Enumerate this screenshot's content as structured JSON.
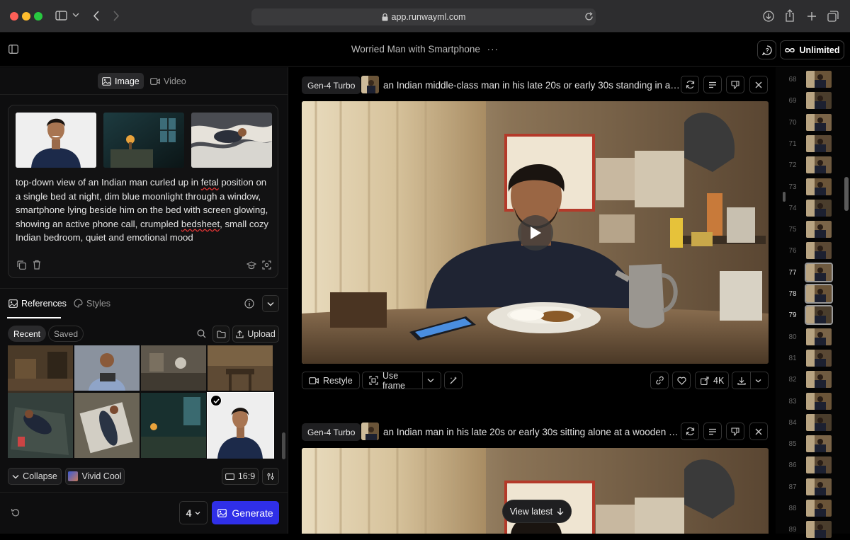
{
  "browser": {
    "url": "app.runwayml.com"
  },
  "header": {
    "title": "Worried Man with Smartphone",
    "more": "···",
    "plan": "Unlimited"
  },
  "left": {
    "mode_tabs": [
      "Image",
      "Video"
    ],
    "prompt": {
      "parts": [
        "top-down view of an Indian man curled up in ",
        "fetal",
        " position on a single bed at night, dim blue moonlight through a window, smartphone lying beside him on the bed with screen glowing, showing an active phone call, crumpled ",
        "bedsheet",
        ", small cozy Indian bedroom, quiet and emotional mood"
      ]
    },
    "panel_tabs": [
      "References",
      "Styles"
    ],
    "filter_tabs": [
      "Recent",
      "Saved"
    ],
    "upload": "Upload",
    "collapse": "Collapse",
    "style": "Vivid Cool",
    "ratio": "16:9",
    "count": "4",
    "generate": "Generate"
  },
  "generations": [
    {
      "model": "Gen-4 Turbo",
      "prompt": "an Indian middle-class man in his late 20s or early 30s standing in a m..."
    },
    {
      "model": "Gen-4 Turbo",
      "prompt": "an Indian man in his late 20s or early 30s sitting alone at a wooden di..."
    }
  ],
  "toolbar": {
    "restyle": "Restyle",
    "use_frame": "Use frame",
    "resolution": "4K"
  },
  "view_latest": "View latest",
  "strip": {
    "numbers": [
      "68",
      "69",
      "70",
      "71",
      "72",
      "73",
      "74",
      "75",
      "76",
      "77",
      "78",
      "79",
      "80",
      "81",
      "82",
      "83",
      "84",
      "85",
      "86",
      "87",
      "88",
      "89"
    ],
    "selected": [
      "77",
      "78",
      "79"
    ]
  },
  "colors": {
    "accent": "#2f2fe8",
    "bg": "#000000",
    "panel": "#0e0e0f"
  },
  "icons": [
    "sidebar-icon",
    "lock-icon",
    "reload-icon",
    "download-icon",
    "share-icon",
    "plus-icon",
    "tabs-icon",
    "chat-icon",
    "infinity-icon",
    "image-icon",
    "video-icon",
    "copy-icon",
    "trash-icon",
    "hat-icon",
    "scan-icon",
    "info-icon",
    "search-icon",
    "folder-icon",
    "upload-icon",
    "refresh-icon",
    "list-icon",
    "thumbs-down-icon",
    "close-icon",
    "play-icon",
    "link-icon",
    "heart-icon",
    "enhance-icon",
    "chevron-down-icon",
    "undo-icon",
    "magic-wand-icon",
    "adjust-icon",
    "arrow-down-icon"
  ]
}
